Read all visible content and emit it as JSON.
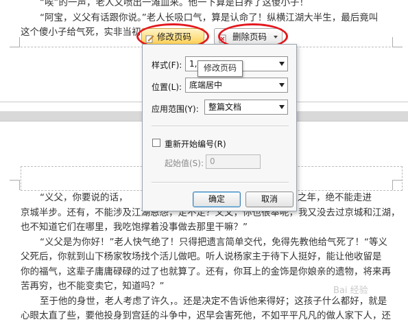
{
  "document": {
    "top_lines": [
      "“唉”的一声，老人又喷出一滩血来。他一下算是白养了这傻小子！",
      "“阿宝，义父有话跟你说。”老人长吸口气，算是认命了！纵横江湖大半生，最后竟叫",
      "这个傻小子给气死，实非当初"
    ],
    "bottom_lines": [
      "“义父，你要说的话，",
      "“有生之年，绝不能走进",
      "京城半步。还有，不能涉及江湖恩怨，走不走？义父，你也很奉呢，我又没去过京城和江湖，",
      "也不知道它们在哪里，我吃饱撑着没事做去那里干嘛？”",
      "“义父是为你好！”老人快气绝了！只得把遗言简单交代，免得先教他给气死了！“等义",
      "父死后，你就到山下杨家牧场找个活儿做吧。听人说杨家主于待下人挺好，能让他收留是",
      "你的福气，这辈子庸庸碌碌的过了也就算了。还有，你耳上的金饰是你娘亲的遗物，将来再",
      "苦再穷，也不能变卖它，知道吗？”",
      "至于他的身世，老人考虑了许久，。还是决定不告诉他来得好；这孩子什么都好，就是",
      "心眼太直了些，要他投身到宫廷的斗争中，迟早会害死他，不如平平凡凡的做人家下人，还"
    ]
  },
  "toolbar": {
    "modify_label": "修改页码",
    "delete_label": "删除页码"
  },
  "tooltip": "修改页码",
  "dialog": {
    "style_label": "样式(F):",
    "style_value": "1,",
    "position_label": "位置(L):",
    "position_value": "底端居中",
    "scope_label": "应用范围(Y):",
    "scope_value": "整篇文档",
    "restart_label": "重新开始编号(R)",
    "start_label": "起始值(S):",
    "start_value": "0",
    "ok_label": "确定",
    "cancel_label": "取消"
  },
  "watermark": "Bai 经验",
  "colors": {
    "highlight_ring": "#e3181e",
    "active_button": "#ffd257",
    "page_gap": "#d9d9d9"
  },
  "icons": [
    "edit-page-number-icon",
    "delete-page-number-icon",
    "dropdown-arrow-icon"
  ]
}
